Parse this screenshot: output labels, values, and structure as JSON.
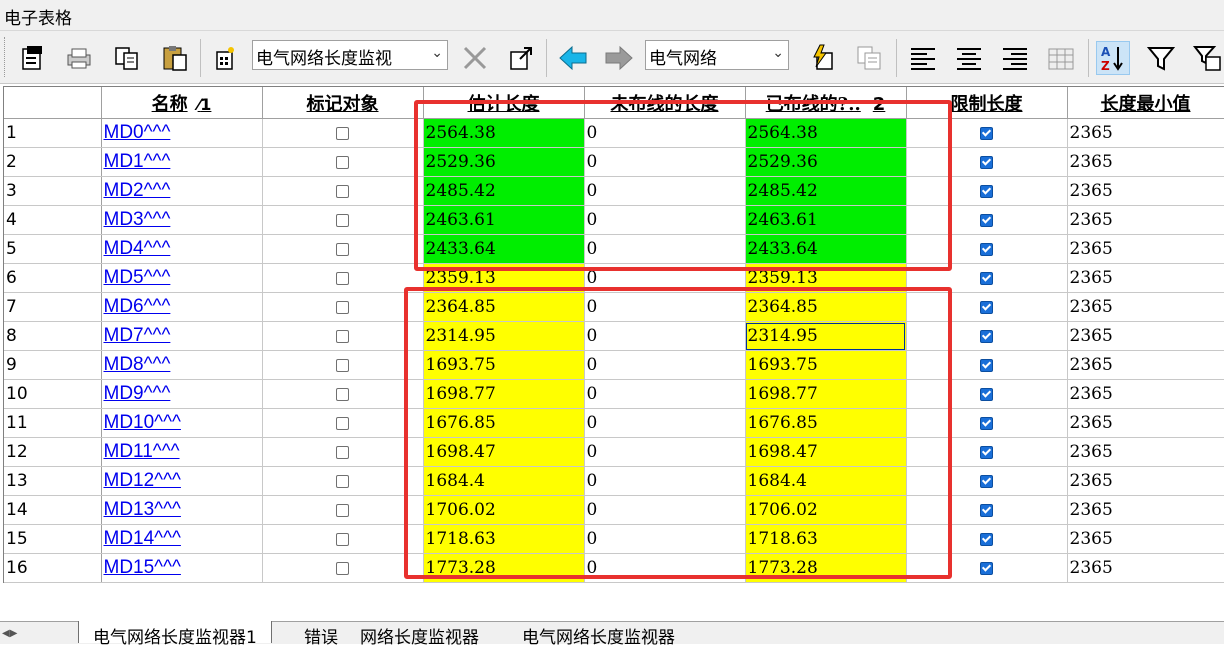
{
  "window": {
    "title": "电子表格"
  },
  "toolbar": {
    "icons": [
      "properties-icon",
      "print-icon",
      "copy-icon",
      "paste-icon",
      "select-icon",
      "close-x-icon",
      "export-icon",
      "arrow-left-icon",
      "arrow-right-icon",
      "flash-icon",
      "layout-icon",
      "align-left-icon",
      "align-center-icon",
      "align-right-icon",
      "table-icon",
      "sort-az-icon",
      "filter-icon",
      "freeze-icon"
    ],
    "view_combo": "电气网络长度监视",
    "type_combo": "电气网络"
  },
  "table": {
    "columns": [
      "名称",
      "标记对象",
      "估计长度",
      "未布线的长度",
      "已布线的?..",
      "限制长度",
      "长度最小值"
    ],
    "sort_indicator": "1",
    "routed_col_suffix": "2",
    "rows": [
      {
        "num": "1",
        "name": "MD0^^^",
        "est": "2564.38",
        "unrouted": "0",
        "routed": "2564.38",
        "limit": true,
        "min": "2365",
        "color": "green"
      },
      {
        "num": "2",
        "name": "MD1^^^",
        "est": "2529.36",
        "unrouted": "0",
        "routed": "2529.36",
        "limit": true,
        "min": "2365",
        "color": "green"
      },
      {
        "num": "3",
        "name": "MD2^^^",
        "est": "2485.42",
        "unrouted": "0",
        "routed": "2485.42",
        "limit": true,
        "min": "2365",
        "color": "green"
      },
      {
        "num": "4",
        "name": "MD3^^^",
        "est": "2463.61",
        "unrouted": "0",
        "routed": "2463.61",
        "limit": true,
        "min": "2365",
        "color": "green"
      },
      {
        "num": "5",
        "name": "MD4^^^",
        "est": "2433.64",
        "unrouted": "0",
        "routed": "2433.64",
        "limit": true,
        "min": "2365",
        "color": "green"
      },
      {
        "num": "6",
        "name": "MD5^^^",
        "est": "2359.13",
        "unrouted": "0",
        "routed": "2359.13",
        "limit": true,
        "min": "2365",
        "color": "yellow"
      },
      {
        "num": "7",
        "name": "MD6^^^",
        "est": "2364.85",
        "unrouted": "0",
        "routed": "2364.85",
        "limit": true,
        "min": "2365",
        "color": "yellow"
      },
      {
        "num": "8",
        "name": "MD7^^^",
        "est": "2314.95",
        "unrouted": "0",
        "routed": "2314.95",
        "limit": true,
        "min": "2365",
        "color": "yellow",
        "selected": true
      },
      {
        "num": "9",
        "name": "MD8^^^",
        "est": "1693.75",
        "unrouted": "0",
        "routed": "1693.75",
        "limit": true,
        "min": "2365",
        "color": "yellow"
      },
      {
        "num": "10",
        "name": "MD9^^^",
        "est": "1698.77",
        "unrouted": "0",
        "routed": "1698.77",
        "limit": true,
        "min": "2365",
        "color": "yellow"
      },
      {
        "num": "11",
        "name": "MD10^^^",
        "est": "1676.85",
        "unrouted": "0",
        "routed": "1676.85",
        "limit": true,
        "min": "2365",
        "color": "yellow"
      },
      {
        "num": "12",
        "name": "MD11^^^",
        "est": "1698.47",
        "unrouted": "0",
        "routed": "1698.47",
        "limit": true,
        "min": "2365",
        "color": "yellow"
      },
      {
        "num": "13",
        "name": "MD12^^^",
        "est": "1684.4",
        "unrouted": "0",
        "routed": "1684.4",
        "limit": true,
        "min": "2365",
        "color": "yellow"
      },
      {
        "num": "14",
        "name": "MD13^^^",
        "est": "1706.02",
        "unrouted": "0",
        "routed": "1706.02",
        "limit": true,
        "min": "2365",
        "color": "yellow"
      },
      {
        "num": "15",
        "name": "MD14^^^",
        "est": "1718.63",
        "unrouted": "0",
        "routed": "1718.63",
        "limit": true,
        "min": "2365",
        "color": "yellow"
      },
      {
        "num": "16",
        "name": "MD15^^^",
        "est": "1773.28",
        "unrouted": "0",
        "routed": "1773.28",
        "limit": true,
        "min": "2365",
        "color": "yellow"
      }
    ]
  },
  "tabs": [
    "电气网络长度监视器1",
    "错误",
    "网络长度监视器",
    "电气网络长度监视器"
  ],
  "colors": {
    "green": "#00ee00",
    "yellow": "#ffff00",
    "annotation": "#e8312e",
    "link": "#0000ee"
  }
}
